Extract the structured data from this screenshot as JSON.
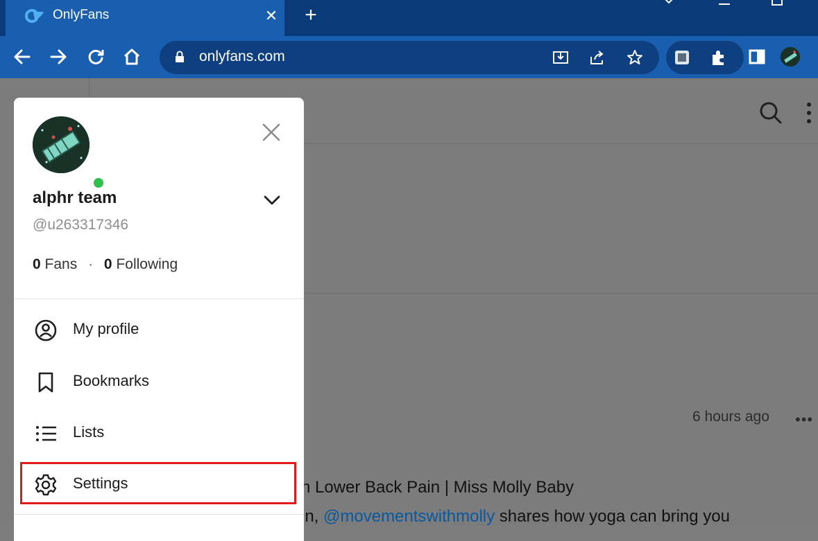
{
  "browser": {
    "tab_title": "OnlyFans",
    "tab_close": "✕",
    "new_tab": "+",
    "url": "onlyfans.com"
  },
  "menu": {
    "user_name": "alphr team",
    "user_handle": "@u263317346",
    "fans_count": "0",
    "fans_label": "Fans",
    "following_count": "0",
    "following_label": "Following",
    "items": [
      {
        "label": "My profile",
        "icon": "user-circle-icon"
      },
      {
        "label": "Bookmarks",
        "icon": "bookmark-icon"
      },
      {
        "label": "Lists",
        "icon": "list-icon"
      },
      {
        "label": "Settings",
        "icon": "gear-icon"
      }
    ],
    "highlighted_item": "Settings"
  },
  "post": {
    "time": "6 hours ago",
    "title_fragment": "h Lower Back Pain | Miss Molly Baby",
    "body_prefix": "in, ",
    "body_mention": "@movementswithmolly",
    "body_suffix": " shares how yoga can bring you"
  },
  "colors": {
    "chrome_dark": "#0a3a78",
    "chrome_tab": "#1a5eb0",
    "highlight": "#e21a1a",
    "online": "#2fbf4a",
    "mention": "#0a58a0"
  }
}
